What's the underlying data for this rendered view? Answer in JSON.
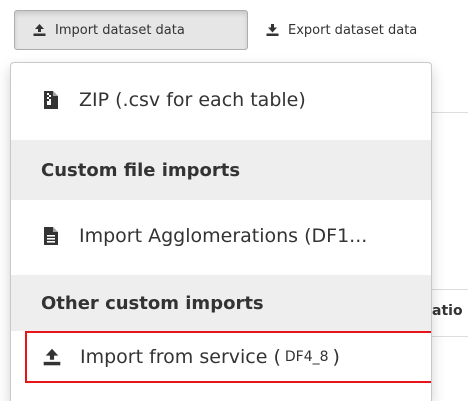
{
  "toolbar": {
    "import_label": "Import dataset data",
    "import_icon": "upload-icon",
    "export_label": "Export dataset data",
    "export_icon": "download-icon"
  },
  "background": {
    "partial_column_header": "atio"
  },
  "menu": {
    "zip_item": {
      "label": "ZIP (.csv for each table)",
      "icon": "zip-file-icon"
    },
    "custom_header": "Custom file imports",
    "agglomerations_item": {
      "label": "Import Agglomerations (DF1...",
      "icon": "file-icon"
    },
    "other_header": "Other custom imports",
    "service_item": {
      "label": "Import from service (",
      "code": "DF4_8",
      "close_paren": ")",
      "icon": "upload-icon"
    }
  },
  "colors": {
    "highlight_border": "#e8141b",
    "header_background": "#eeeeee",
    "active_button_background": "#e6e6e6"
  }
}
